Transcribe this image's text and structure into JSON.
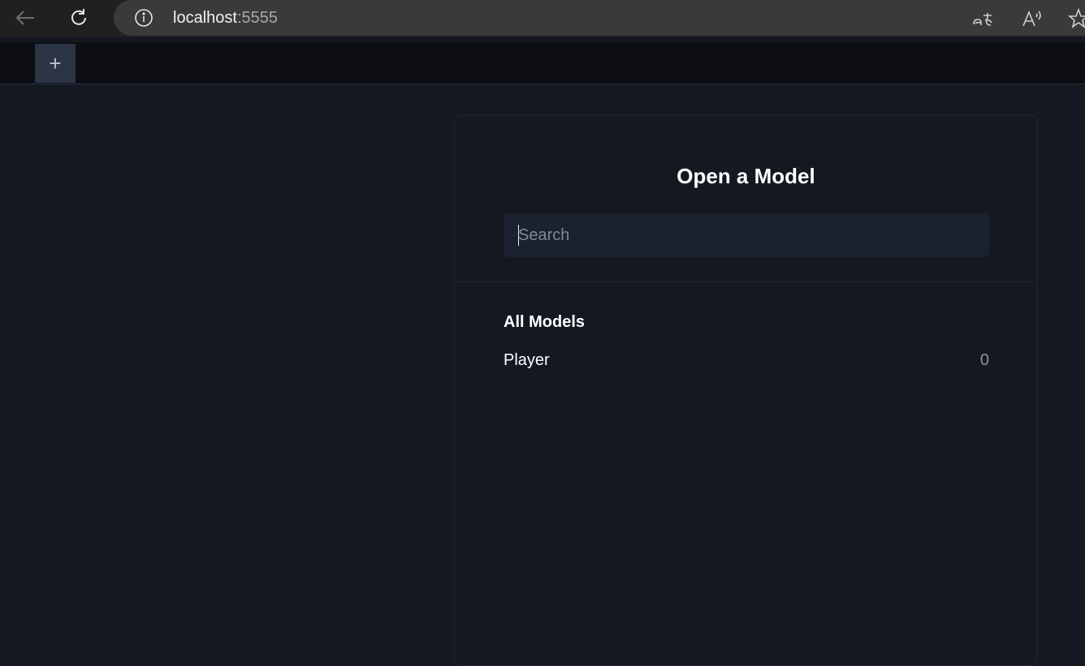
{
  "browser": {
    "url_host": "localhost",
    "url_port": ":5555",
    "icons": {
      "back": "back-arrow-icon",
      "reload": "reload-icon",
      "info": "info-icon",
      "translate": "translate-icon",
      "read_aloud": "read-aloud-icon",
      "favorite": "favorite-star-icon"
    }
  },
  "tab_bar": {
    "new_tab_label": "+"
  },
  "panel": {
    "title": "Open a Model",
    "search": {
      "placeholder": "Search",
      "value": ""
    },
    "section_title": "All Models",
    "models": [
      {
        "name": "Player",
        "count": "0"
      }
    ]
  },
  "colors": {
    "background": "#131821",
    "tab_bar": "#0c0e13",
    "input_bg": "#1c2130",
    "new_tab_button": "#2b3546"
  }
}
